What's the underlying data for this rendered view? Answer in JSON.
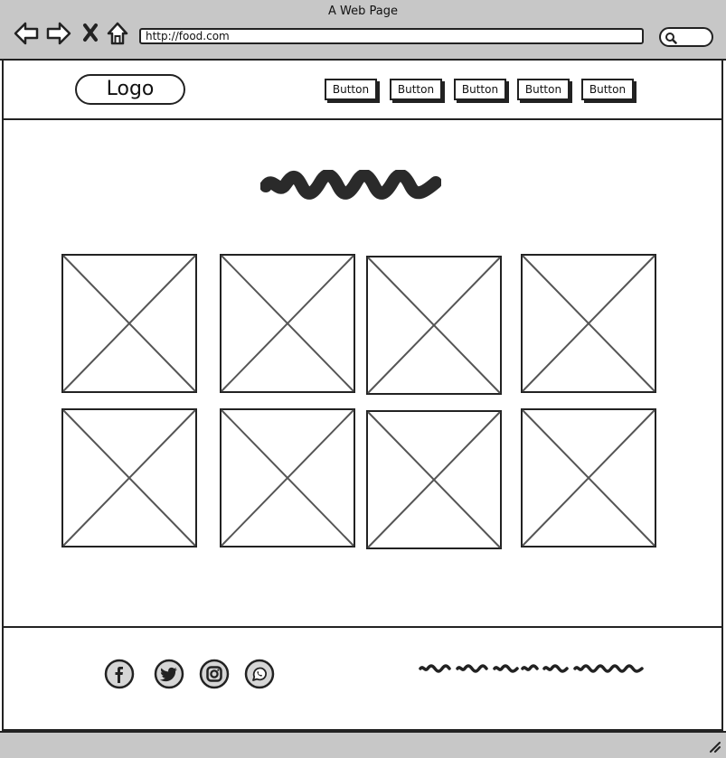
{
  "window": {
    "title": "A Web Page"
  },
  "browser": {
    "url": "http://food.com",
    "icons": [
      "back-arrow-icon",
      "forward-arrow-icon",
      "close-x-icon",
      "home-icon",
      "search-icon"
    ]
  },
  "header": {
    "logo_label": "Logo",
    "nav_buttons": [
      "Button",
      "Button",
      "Button",
      "Button",
      "Button"
    ]
  },
  "main": {
    "image_grid": {
      "rows": 2,
      "columns": 4,
      "placeholder": "image-placeholder"
    }
  },
  "footer": {
    "social_icons": [
      "facebook-icon",
      "twitter-icon",
      "instagram-icon",
      "whatsapp-icon"
    ]
  },
  "colors": {
    "chrome": "#c7c7c7",
    "ink": "#222222",
    "page": "#ffffff"
  }
}
